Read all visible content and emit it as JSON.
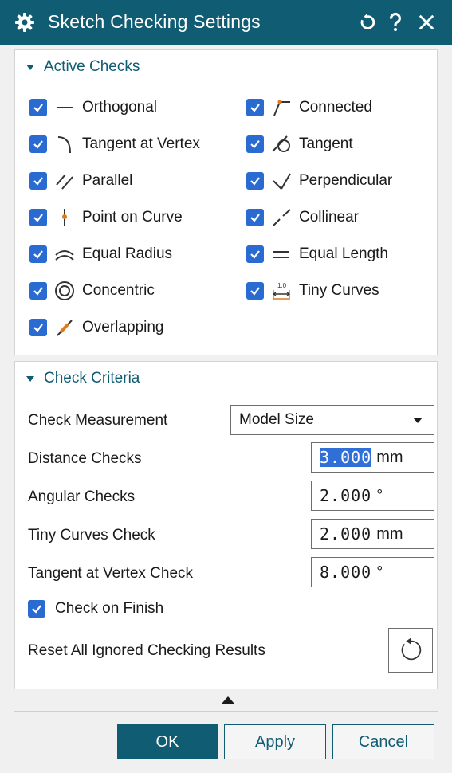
{
  "window": {
    "title": "Sketch Checking Settings"
  },
  "active_checks": {
    "heading": "Active Checks",
    "left": [
      {
        "label": "Orthogonal",
        "icon": "orthogonal-icon",
        "checked": true
      },
      {
        "label": "Tangent at Vertex",
        "icon": "tangent-at-vertex-icon",
        "checked": true
      },
      {
        "label": "Parallel",
        "icon": "parallel-icon",
        "checked": true
      },
      {
        "label": "Point on Curve",
        "icon": "point-on-curve-icon",
        "checked": true
      },
      {
        "label": "Equal Radius",
        "icon": "equal-radius-icon",
        "checked": true
      },
      {
        "label": "Concentric",
        "icon": "concentric-icon",
        "checked": true
      },
      {
        "label": "Overlapping",
        "icon": "overlapping-icon",
        "checked": true
      }
    ],
    "right": [
      {
        "label": "Connected",
        "icon": "connected-icon",
        "checked": true
      },
      {
        "label": "Tangent",
        "icon": "tangent-icon",
        "checked": true
      },
      {
        "label": "Perpendicular",
        "icon": "perpendicular-icon",
        "checked": true
      },
      {
        "label": "Collinear",
        "icon": "collinear-icon",
        "checked": true
      },
      {
        "label": "Equal Length",
        "icon": "equal-length-icon",
        "checked": true
      },
      {
        "label": "Tiny Curves",
        "icon": "tiny-curves-icon",
        "checked": true
      }
    ]
  },
  "criteria": {
    "heading": "Check Criteria",
    "measurement": {
      "label": "Check Measurement",
      "value": "Model Size"
    },
    "distance": {
      "label": "Distance Checks",
      "value": "3.000",
      "unit": "mm"
    },
    "angular": {
      "label": "Angular Checks",
      "value": "2.000",
      "unit": "°"
    },
    "tiny": {
      "label": "Tiny Curves Check",
      "value": "2.000",
      "unit": "mm"
    },
    "tangent_vertex": {
      "label": "Tangent at Vertex Check",
      "value": "8.000",
      "unit": "°"
    },
    "check_on_finish": {
      "label": "Check on Finish",
      "checked": true
    },
    "reset_label": "Reset All Ignored Checking Results"
  },
  "buttons": {
    "ok": "OK",
    "apply": "Apply",
    "cancel": "Cancel"
  },
  "icons": {
    "tiny_curves_badge": "1.0"
  },
  "colors": {
    "titlebar": "#0f5c73",
    "checkbox": "#2a6bd1",
    "accent": "#0f5c73",
    "selection": "#2f6fd6"
  }
}
